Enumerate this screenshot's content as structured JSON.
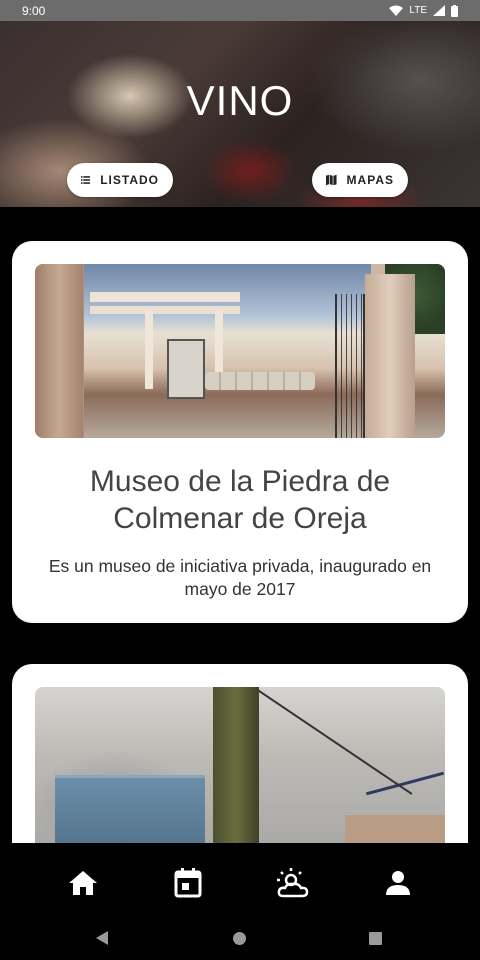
{
  "status_bar": {
    "time": "9:00",
    "network": "LTE",
    "icons": [
      "wifi-icon",
      "lte-signal-icon",
      "battery-icon"
    ]
  },
  "header": {
    "title": "VINO",
    "buttons": [
      {
        "label": "LISTADO",
        "icon": "list-icon"
      },
      {
        "label": "MAPAS",
        "icon": "map-icon"
      }
    ]
  },
  "feed": {
    "cards": [
      {
        "title": "Museo de la Piedra de Colmenar de Oreja",
        "description": "Es un museo de iniciativa privada, inaugurado en mayo de 2017",
        "image": "museum-courtyard-photo"
      },
      {
        "title": "",
        "description": "",
        "image": "smoking-pole-photo"
      }
    ]
  },
  "bottom_nav": {
    "items": [
      {
        "icon": "home-icon",
        "active": true
      },
      {
        "icon": "calendar-icon",
        "active": false
      },
      {
        "icon": "weather-icon",
        "active": false
      },
      {
        "icon": "profile-icon",
        "active": false
      }
    ]
  },
  "system_nav": [
    "back-button",
    "home-button",
    "recents-button"
  ],
  "colors": {
    "background": "#000000",
    "card": "#ffffff",
    "title_text": "#444444",
    "status_bar": "#6c6c6c"
  }
}
